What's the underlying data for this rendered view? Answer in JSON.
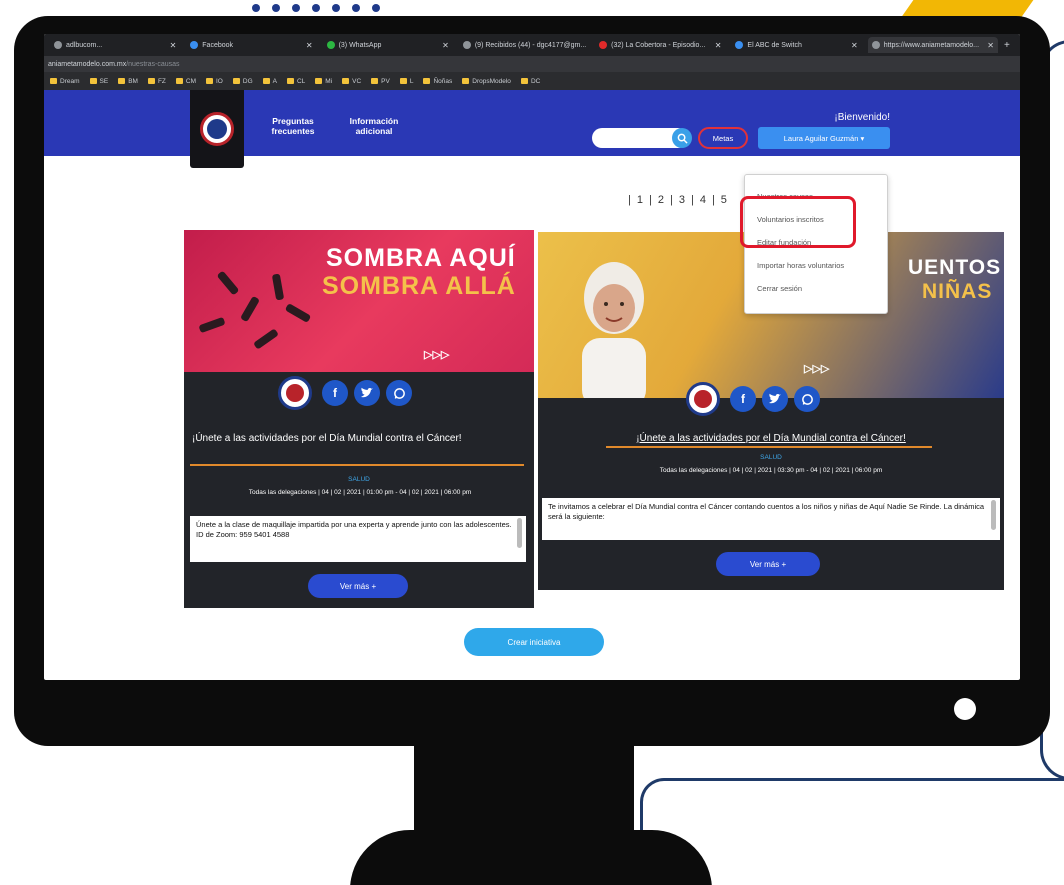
{
  "browser": {
    "tabs": [
      {
        "label": "adlbucom...",
        "icon": "gray"
      },
      {
        "label": "Facebook",
        "icon": "blue"
      },
      {
        "label": "(3) WhatsApp",
        "icon": "green"
      },
      {
        "label": "(9) Recibidos (44) - dgc4177@gm...",
        "icon": "gray"
      },
      {
        "label": "(32) La Cobertora - Episodio...",
        "icon": "red"
      },
      {
        "label": "El ABC de Switch",
        "icon": "blue"
      },
      {
        "label": "https://www.aniametamodelo...",
        "icon": "gray"
      }
    ],
    "url_main": "aniametamodelo.com.mx",
    "url_path": "/nuestras-causas",
    "bookmarks": [
      "Dream",
      "SE",
      "BM",
      "FZ",
      "CM",
      "IO",
      "DG",
      "A",
      "CL",
      "Mi",
      "VC",
      "PV",
      "L",
      "Ñoñas",
      "DropsModelo",
      "DC"
    ]
  },
  "header": {
    "nav_faq": "Preguntas frecuentes",
    "nav_info": "Información adicional",
    "welcome": "¡Bienvenido!",
    "metas": "Metas",
    "user": "Laura Aguilar Guzmán ▾"
  },
  "dropdown": {
    "items": [
      "Nuestras causas",
      "Voluntarios inscritos",
      "Editar fundación",
      "Importar horas voluntarios",
      "Cerrar sesión"
    ]
  },
  "pagination": [
    "1",
    "2",
    "3",
    "4",
    "5"
  ],
  "cards": [
    {
      "banner_line1": "SOMBRA AQUÍ",
      "banner_line2": "SOMBRA ALLÁ",
      "title": "¡Únete a las actividades por el Día Mundial contra el Cáncer!",
      "category": "SALUD",
      "meta": "Todas las delegaciones | 04 | 02 | 2021 | 01:00 pm - 04 | 02 | 2021 | 06:00 pm",
      "description": "Únete a la clase de maquillaje impartida por una experta y aprende junto con las adolescentes. ID de Zoom: 959 5401 4588",
      "button": "Ver más +"
    },
    {
      "banner_line1": "UENTOS",
      "banner_line2": "NIÑAS",
      "title": "¡Únete a las actividades por el Día Mundial contra el Cáncer!",
      "category": "SALUD",
      "meta": "Todas las delegaciones | 04 | 02 | 2021 | 03:30 pm - 04 | 02 | 2021 | 06:00 pm",
      "description": "Te invitamos a celebrar el Día Mundial contra el Cáncer contando cuentos a los niños y niñas de Aquí Nadie Se Rinde. La dinámica será la siguiente:",
      "button": "Ver más +"
    }
  ],
  "crear_button": "Crear iniciativa",
  "colors": {
    "header_blue": "#2a38b5",
    "highlight_red": "#e0192b",
    "button_blue": "#2a4bd0",
    "crear_blue": "#2fa8ea"
  }
}
